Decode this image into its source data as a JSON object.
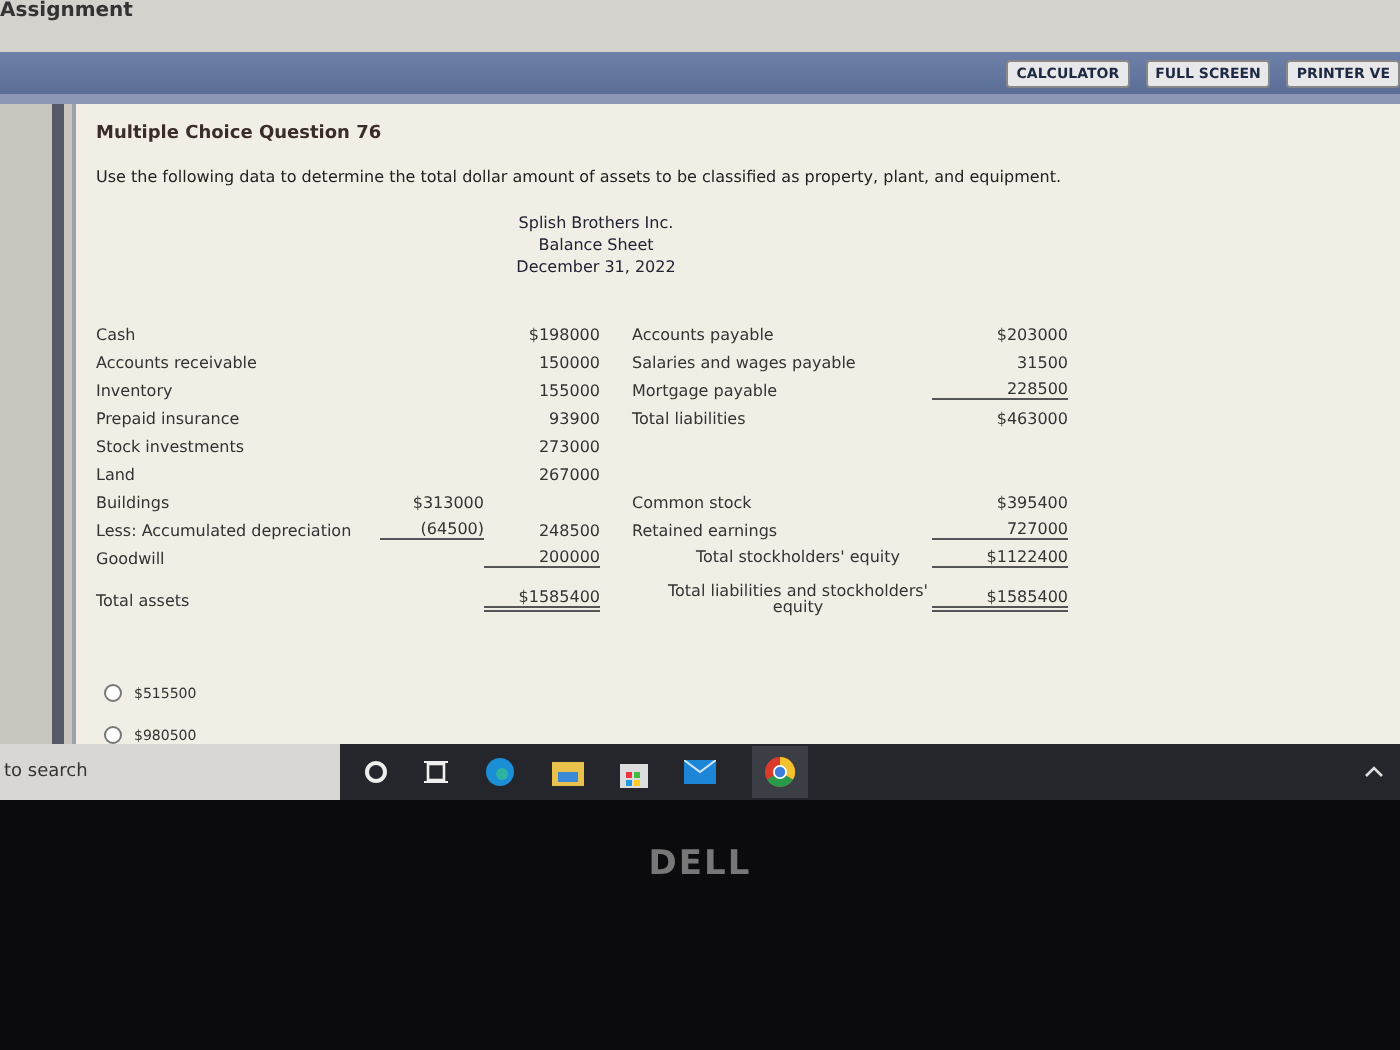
{
  "page_heading": "Assignment",
  "toolbar": {
    "buttons": [
      "CALCULATOR",
      "FULL SCREEN",
      "PRINTER VE"
    ]
  },
  "question": {
    "title": "Multiple Choice Question 76",
    "prompt": "Use the following data to determine the total dollar amount of assets to be classified as property, plant, and equipment."
  },
  "statement": {
    "header": [
      "Splish Brothers Inc.",
      "Balance Sheet",
      "December 31, 2022"
    ],
    "assets": [
      {
        "kind": "plain",
        "label": "Cash",
        "amount": "$198000"
      },
      {
        "kind": "plain",
        "label": "Accounts receivable",
        "amount": "150000"
      },
      {
        "kind": "plain",
        "label": "Inventory",
        "amount": "155000"
      },
      {
        "kind": "plain",
        "label": "Prepaid insurance",
        "amount": "93900"
      },
      {
        "kind": "plain",
        "label": "Stock investments",
        "amount": "273000"
      },
      {
        "kind": "plain",
        "label": "Land",
        "amount": "267000"
      },
      {
        "kind": "plain",
        "label": "Buildings",
        "sub": "$313000"
      },
      {
        "kind": "contra",
        "label": "Less: Accumulated depreciation",
        "sub": "(64500)",
        "amount": "248500"
      },
      {
        "kind": "underlined",
        "label": "Goodwill",
        "amount": "200000"
      },
      {
        "kind": "total",
        "label": "Total assets",
        "amount": "$1585400"
      }
    ],
    "liabilities": [
      {
        "kind": "plain",
        "label": "Accounts payable",
        "amount": "$203000",
        "indent": false
      },
      {
        "kind": "plain",
        "label": "Salaries and wages payable",
        "amount": "31500",
        "indent": false
      },
      {
        "kind": "underlined",
        "label": "Mortgage payable",
        "amount": "228500",
        "indent": false
      },
      {
        "kind": "plain",
        "label": "Total liabilities",
        "amount": "$463000",
        "indent": false
      }
    ],
    "equity": [
      {
        "kind": "plain",
        "label": "Common stock",
        "amount": "$395400",
        "indent": false
      },
      {
        "kind": "underlined",
        "label": "Retained earnings",
        "amount": "727000",
        "indent": false
      },
      {
        "kind": "underlined",
        "label": "Total stockholders' equity",
        "amount": "$1122400",
        "indent": true
      },
      {
        "kind": "total",
        "label": "Total liabilities and stockholders' equity",
        "amount": "$1585400",
        "indent": true
      }
    ]
  },
  "options": [
    {
      "label": "$515500",
      "selected": false
    },
    {
      "label": "$980500",
      "selected": false
    }
  ],
  "taskbar": {
    "search_placeholder": "to search"
  },
  "bezel": {
    "logo": "DELL"
  }
}
